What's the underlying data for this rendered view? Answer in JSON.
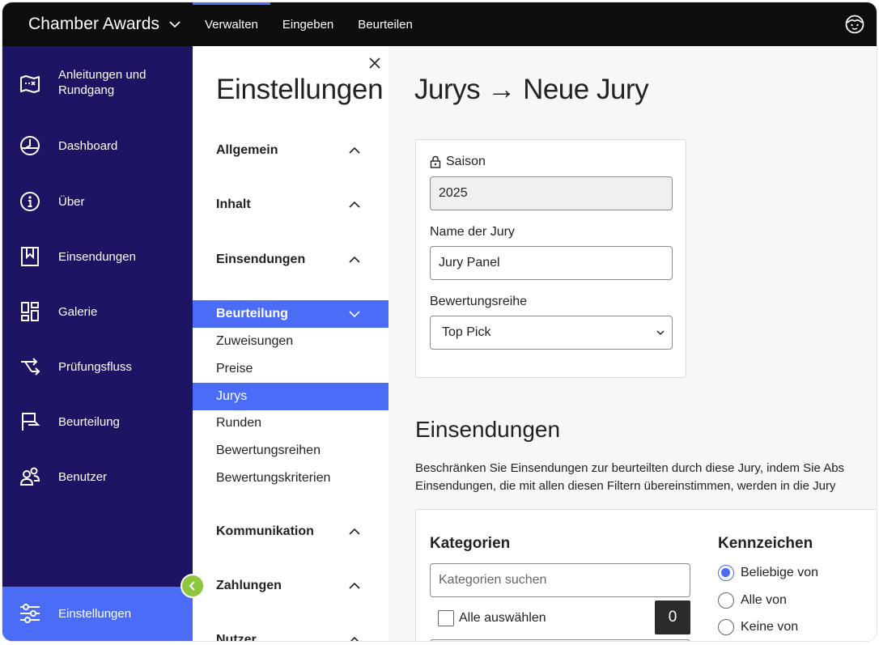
{
  "topbar": {
    "app_name": "Chamber Awards",
    "nav": [
      "Verwalten",
      "Eingeben",
      "Beurteilen"
    ]
  },
  "sidebar": {
    "items": [
      {
        "label": "Anleitungen und Rundgang",
        "icon": "map-icon"
      },
      {
        "label": "Dashboard",
        "icon": "dashboard-gauge-icon"
      },
      {
        "label": "Über",
        "icon": "info-icon"
      },
      {
        "label": "Einsendungen",
        "icon": "bookmark-icon"
      },
      {
        "label": "Galerie",
        "icon": "gallery-icon"
      },
      {
        "label": "Prüfungsfluss",
        "icon": "flow-icon"
      },
      {
        "label": "Beurteilung",
        "icon": "flag-icon"
      },
      {
        "label": "Benutzer",
        "icon": "users-icon"
      }
    ],
    "bottom": {
      "label": "Einstellungen",
      "icon": "sliders-icon"
    }
  },
  "settings": {
    "title": "Einstellungen",
    "sections": {
      "allgemein": "Allgemein",
      "inhalt": "Inhalt",
      "einsendungen": "Einsendungen",
      "beurteilung": "Beurteilung",
      "kommunikation": "Kommunikation",
      "zahlungen": "Zahlungen",
      "nutzer": "Nutzer"
    },
    "beurteilung_items": [
      "Zuweisungen",
      "Preise",
      "Jurys",
      "Runden",
      "Bewertungsreihen",
      "Bewertungskriterien"
    ]
  },
  "main": {
    "title": "Jurys → Neue Jury",
    "saison_label": "Saison",
    "saison_value": "2025",
    "name_label": "Name der Jury",
    "name_value": "Jury Panel",
    "reihe_label": "Bewertungsreihe",
    "reihe_value": "Top Pick",
    "einsendungen_title": "Einsendungen",
    "desc_line1": "Beschränken Sie Einsendungen zur beurteilten durch diese Jury, indem Sie Abs",
    "desc_line2": "Einsendungen, die mit allen diesen Filtern übereinstimmen, werden in die Jury",
    "kategorien_title": "Kategorien",
    "kategorien_placeholder": "Kategorien suchen",
    "alle_auswaehlen": "Alle auswählen",
    "selected_count": "0",
    "kennzeichen_title": "Kennzeichen",
    "kennzeichen_options": [
      "Beliebige von",
      "Alle von",
      "Keine von"
    ]
  },
  "colors": {
    "accent": "#4a6cf7",
    "sidebar_bg": "#1e1464",
    "topbar_bg": "#0d0d0d",
    "collapse_button": "#8dc63f"
  }
}
